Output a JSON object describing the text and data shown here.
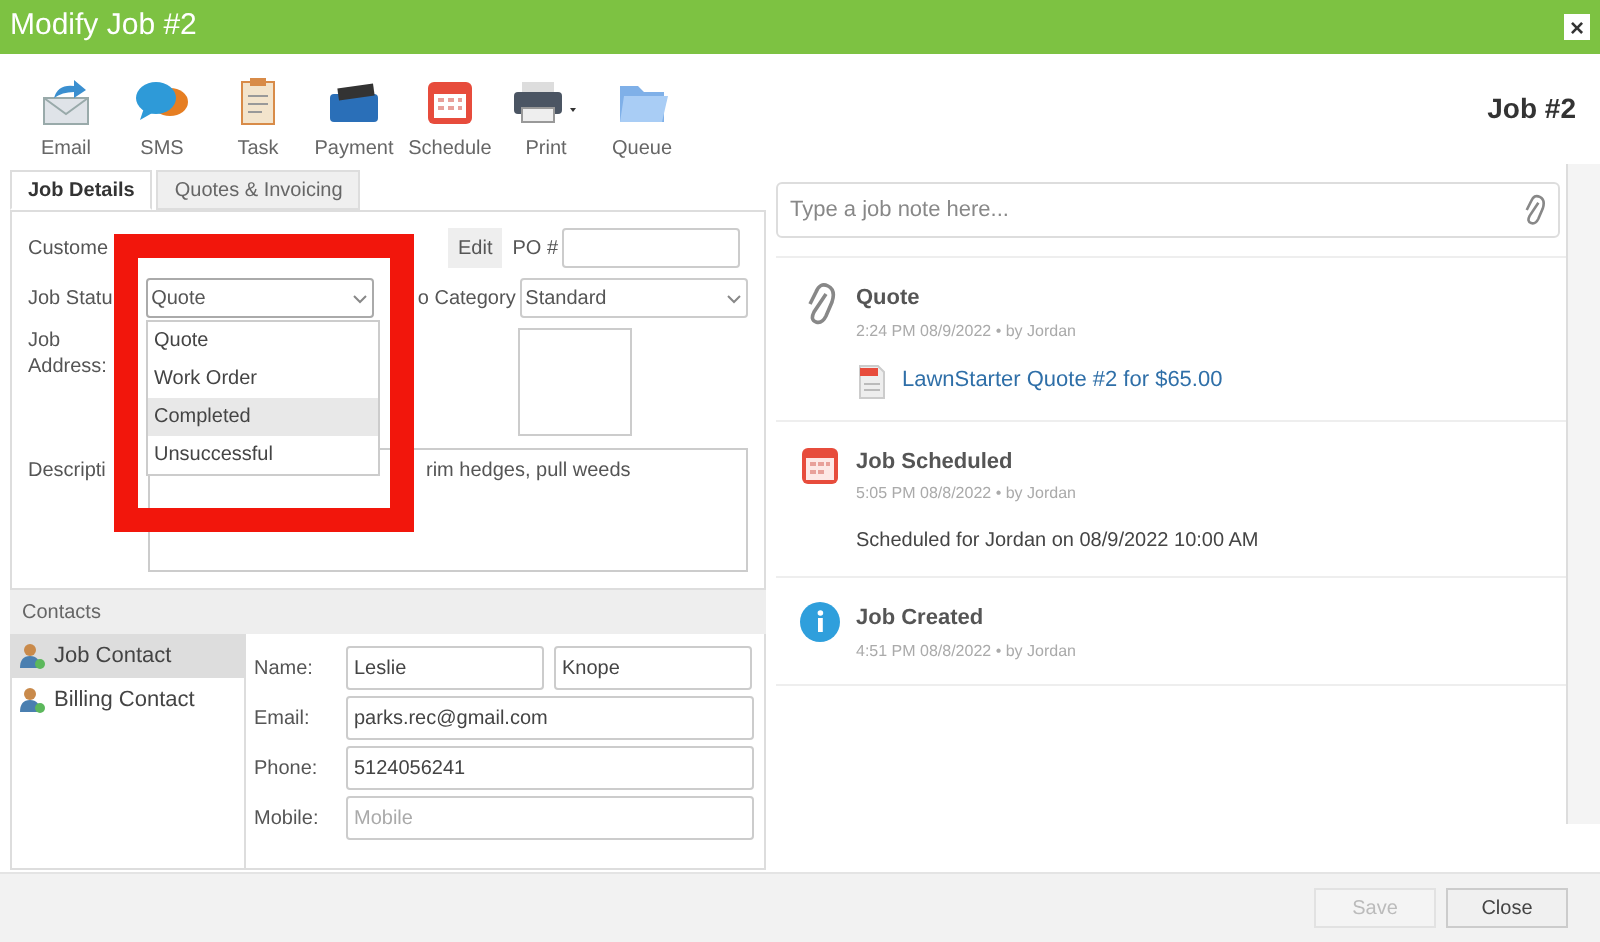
{
  "window": {
    "title": "Modify Job #2",
    "close": "×"
  },
  "toolbar": [
    {
      "label": "Email",
      "kind": "email"
    },
    {
      "label": "SMS",
      "kind": "sms"
    },
    {
      "label": "Task",
      "kind": "task"
    },
    {
      "label": "Payment",
      "kind": "payment"
    },
    {
      "label": "Schedule",
      "kind": "schedule"
    },
    {
      "label": "Print",
      "kind": "print"
    },
    {
      "label": "Queue",
      "kind": "queue"
    }
  ],
  "job_heading": "Job #2",
  "tabs": [
    {
      "label": "Job Details",
      "selected": true
    },
    {
      "label": "Quotes & Invoicing",
      "selected": false
    }
  ],
  "form": {
    "customer_label": "Custome",
    "edit_button": "Edit",
    "po_label": "PO #",
    "status_label": "Job Statu",
    "status_value": "Quote",
    "category_label": "o Category",
    "category_value": "Standard",
    "address_label": "Job Address:",
    "description_label": "Descripti",
    "description_value": "rim hedges, pull weeds"
  },
  "status_options": [
    {
      "label": "Quote",
      "selected": false
    },
    {
      "label": "Work Order",
      "selected": false
    },
    {
      "label": "Completed",
      "selected": true
    },
    {
      "label": "Unsuccessful",
      "selected": false
    }
  ],
  "contacts": {
    "title": "Contacts",
    "items": [
      {
        "label": "Job Contact",
        "selected": true
      },
      {
        "label": "Billing Contact",
        "selected": false
      }
    ],
    "fields": [
      {
        "label": "Name:",
        "values": [
          "Leslie",
          "Knope"
        ]
      },
      {
        "label": "Email:",
        "values": [
          "parks.rec@gmail.com"
        ]
      },
      {
        "label": "Phone:",
        "values": [
          "5124056241"
        ]
      },
      {
        "label": "Mobile:",
        "placeholder": "Mobile"
      }
    ]
  },
  "note": {
    "placeholder": "Type a job note here..."
  },
  "timeline": [
    {
      "kind": "attachment",
      "title": "Quote",
      "meta": "2:24 PM 08/9/2022 •  by Jordan",
      "link": "LawnStarter Quote #2 for $65.00"
    },
    {
      "kind": "scheduled",
      "title": "Job Scheduled",
      "meta": "5:05 PM 08/8/2022 •  by Jordan",
      "text": "Scheduled for Jordan on 08/9/2022 10:00 AM"
    },
    {
      "kind": "created",
      "title": "Job Created",
      "meta": "4:51 PM 08/8/2022 •  by Jordan"
    }
  ],
  "buttons": [
    {
      "label": "Save",
      "disabled": true
    },
    {
      "label": "Close",
      "disabled": false
    }
  ]
}
